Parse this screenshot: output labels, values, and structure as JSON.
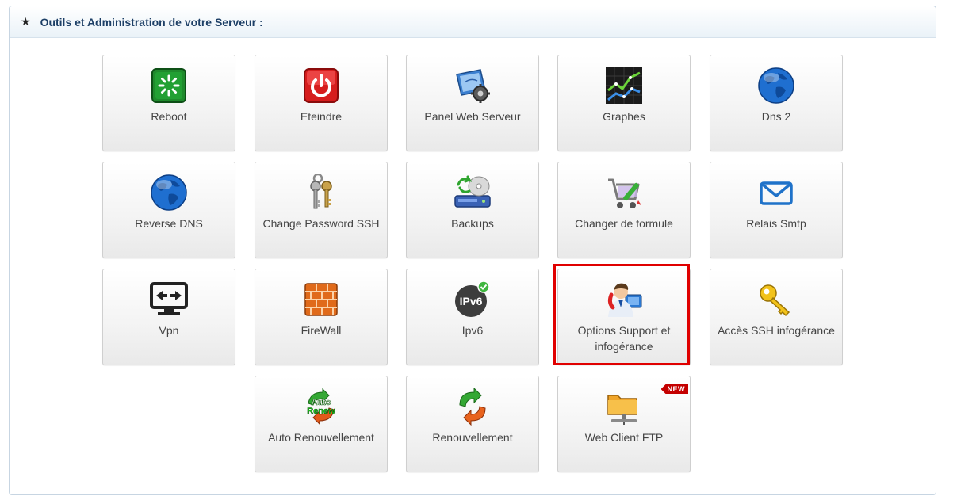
{
  "panel": {
    "title": "Outils et Administration de votre Serveur :"
  },
  "tiles": {
    "reboot": "Reboot",
    "eteindre": "Eteindre",
    "panel_web": "Panel Web Serveur",
    "graphes": "Graphes",
    "dns2": "Dns 2",
    "reverse_dns": "Reverse DNS",
    "change_password": "Change Password SSH",
    "backups": "Backups",
    "changer_formule": "Changer de formule",
    "relais_smtp": "Relais Smtp",
    "vpn": "Vpn",
    "firewall": "FireWall",
    "ipv6": "Ipv6",
    "options_support_line1": "Options Support et",
    "options_support_line2": "infogérance",
    "acces_ssh": "Accès SSH infogérance",
    "auto_renouvellement": "Auto Renouvellement",
    "renouvellement": "Renouvellement",
    "web_client_ftp": "Web Client FTP"
  },
  "icon_texts": {
    "ipv6": "IPv6",
    "auto_renew_1": "Auto",
    "auto_renew_2": "Renew"
  },
  "badge": {
    "new": "NEW"
  },
  "colors": {
    "highlight": "#e00000",
    "title": "#1d3f66"
  }
}
